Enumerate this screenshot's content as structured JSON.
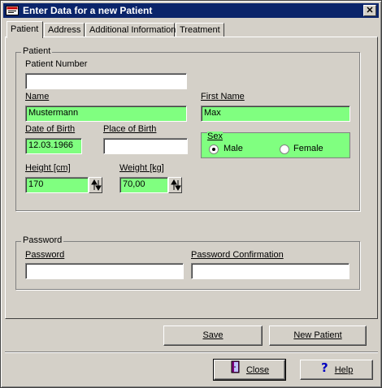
{
  "window": {
    "title": "Enter Data for a new Patient",
    "close_glyph": "✕"
  },
  "tabs": [
    "Patient",
    "Address",
    "Additional Information",
    "Treatment"
  ],
  "patient_group": {
    "title": "Patient",
    "patient_number": {
      "label": "Patient Number",
      "value": ""
    },
    "name": {
      "label": "Name",
      "value": "Mustermann"
    },
    "first_name": {
      "label": "First Name",
      "value": "Max"
    },
    "date_of_birth": {
      "label": "Date of Birth",
      "value": "12.03.1966"
    },
    "place_of_birth": {
      "label": "Place of Birth",
      "value": ""
    },
    "sex": {
      "label": "Sex",
      "options": [
        "Male",
        "Female"
      ],
      "selected": "Male"
    },
    "height": {
      "label": "Height [cm]",
      "value": "170"
    },
    "weight": {
      "label": "Weight [kg]",
      "value": "70,00"
    }
  },
  "password_group": {
    "title": "Password",
    "password": {
      "label": "Password",
      "value": ""
    },
    "confirmation": {
      "label": "Password Confirmation",
      "value": ""
    }
  },
  "buttons": {
    "save": "Save",
    "new_patient": "New Patient",
    "close": "Close",
    "help": "Help"
  },
  "colors": {
    "title_bar": "#0a246a",
    "required_field": "#80ff80",
    "face": "#d4d0c8"
  },
  "icons": {
    "app": "patient-card-icon",
    "close": "door-exit-icon",
    "help": "question-mark-icon",
    "spin": "up-down-arrows-icon"
  }
}
